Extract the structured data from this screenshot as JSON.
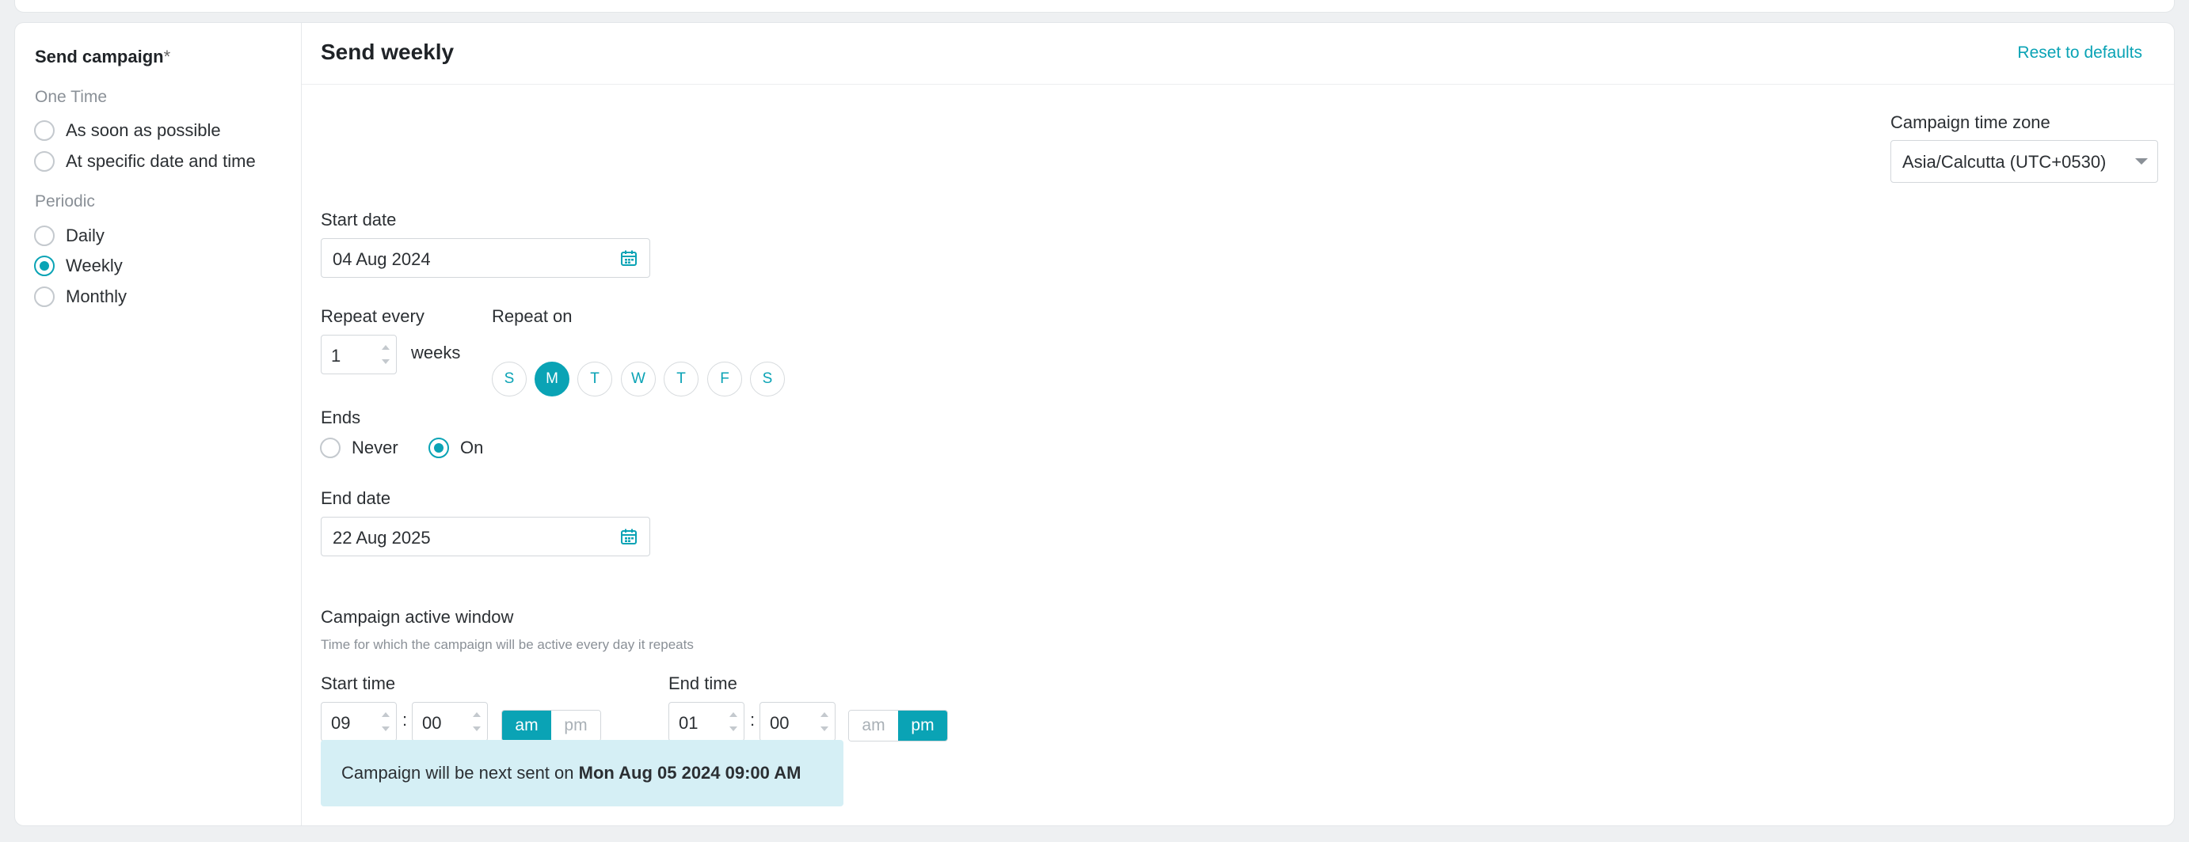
{
  "sidebar": {
    "title": "Send campaign",
    "required_mark": "*",
    "one_time_label": "One Time",
    "periodic_label": "Periodic",
    "options": {
      "asap": "As soon as possible",
      "specific": "At specific date and time",
      "daily": "Daily",
      "weekly": "Weekly",
      "monthly": "Monthly"
    },
    "selected": "Weekly"
  },
  "header": {
    "title": "Send weekly",
    "reset_label": "Reset to defaults"
  },
  "timezone": {
    "label": "Campaign time zone",
    "value": "Asia/Calcutta (UTC+0530)"
  },
  "start_date": {
    "label": "Start date",
    "value": "04 Aug 2024"
  },
  "repeat": {
    "every_label": "Repeat every",
    "every_value": "1",
    "unit": "weeks",
    "on_label": "Repeat on",
    "days": [
      "S",
      "M",
      "T",
      "W",
      "T",
      "F",
      "S"
    ],
    "selected_day": "M"
  },
  "ends": {
    "label": "Ends",
    "never_label": "Never",
    "on_label": "On",
    "selected": "On"
  },
  "end_date": {
    "label": "End date",
    "value": "22 Aug 2025"
  },
  "active_window": {
    "label": "Campaign active window",
    "description": "Time for which the campaign will be active every day it repeats",
    "start_label": "Start time",
    "start_hour": "09",
    "start_minute": "00",
    "start_period": "am",
    "end_label": "End time",
    "end_hour": "01",
    "end_minute": "00",
    "end_period": "pm",
    "am_label": "am",
    "pm_label": "pm",
    "separator": ":"
  },
  "next_send": {
    "prefix": "Campaign will be next sent on",
    "datetime": "Mon Aug 05 2024 09:00 AM"
  },
  "colors": {
    "accent": "#0aa3b5",
    "info_bg": "#d5eff5"
  }
}
